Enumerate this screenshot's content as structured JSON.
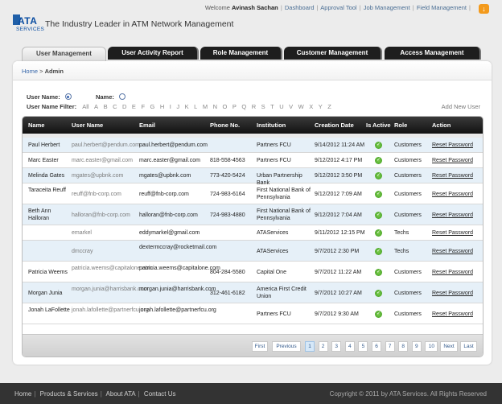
{
  "header": {
    "logo_text": "ATA",
    "logo_sub": "SERVICES",
    "tagline": "The Industry Leader in ATM Network Management",
    "welcome_prefix": "Welcome",
    "user_name": "Avinash Sachan",
    "links": [
      "Dashboard",
      "Approval Tool",
      "Job Management",
      "Field Management"
    ],
    "download_icon": "download-icon"
  },
  "tabs": [
    {
      "label": "User Management",
      "active": true
    },
    {
      "label": "User Activity Report",
      "active": false
    },
    {
      "label": "Role Management",
      "active": false
    },
    {
      "label": "Customer Management",
      "active": false
    },
    {
      "label": "Access Management",
      "active": false
    }
  ],
  "breadcrumb": {
    "home": "Home",
    "sep": ">",
    "current": "Admin"
  },
  "filters": {
    "user_name_label": "User Name:",
    "name_label": "Name:",
    "filter_label": "User Name Filter:",
    "letters": [
      "All",
      "A",
      "B",
      "C",
      "D",
      "E",
      "F",
      "G",
      "H",
      "I",
      "J",
      "K",
      "L",
      "M",
      "N",
      "O",
      "P",
      "Q",
      "R",
      "S",
      "T",
      "U",
      "V",
      "W",
      "X",
      "Y",
      "Z"
    ],
    "add_new_user": "Add New User"
  },
  "table": {
    "headers": [
      "Name",
      "User Name",
      "Email",
      "Phone No.",
      "Institution",
      "Creation Date",
      "Is Active",
      "Role",
      "Action"
    ],
    "rows": [
      {
        "name": "Paul Herbert",
        "user": "paul.herbert@pendum.com",
        "email": "paul.herbert@pendum.com",
        "phone": "",
        "inst": "Partners FCU",
        "date": "9/14/2012 11:24 AM",
        "role": "Customers",
        "action": "Reset Password"
      },
      {
        "name": "Marc Easter",
        "user": "marc.easter@gmail.com",
        "email": "marc.easter@gmail.com",
        "phone": "818-558-4563",
        "inst": "Partners FCU",
        "date": "9/12/2012 4:17 PM",
        "role": "Customers",
        "action": "Reset Password"
      },
      {
        "name": "Melinda Gates",
        "user": "mgates@upbnk.com",
        "email": "mgates@upbnk.com",
        "phone": "773-420-5424",
        "inst": "Urban Partnership Bank",
        "date": "9/12/2012 3:50 PM",
        "role": "Customers",
        "action": "Reset Password"
      },
      {
        "name": "Taraceita Reuff",
        "user": "reuff@fnb-corp.com",
        "email": "reuff@fnb-corp.com",
        "phone": "724-983-6164",
        "inst": "First National Bank of Pennsylvania",
        "date": "9/12/2012 7:09 AM",
        "role": "Customers",
        "action": "Reset Password"
      },
      {
        "name": "Beth Ann Halloran",
        "user": "halloran@fnb-corp.com",
        "email": "halloran@fnb-corp.com",
        "phone": "724-983-4880",
        "inst": "First National Bank of Pennsylvania",
        "date": "9/12/2012 7:04 AM",
        "role": "Customers",
        "action": "Reset Password"
      },
      {
        "name": "",
        "user": "emarkel",
        "email": "eddymarkel@gmail.com",
        "phone": "",
        "inst": "ATAServices",
        "date": "9/11/2012 12:15 PM",
        "role": "Techs",
        "action": "Reset Password"
      },
      {
        "name": "",
        "user": "dmccray",
        "email": "dextermccray@rocketmail.com",
        "phone": "",
        "inst": "ATAServices",
        "date": "9/7/2012 2:30 PM",
        "role": "Techs",
        "action": "Reset Password"
      },
      {
        "name": "Patricia Weems",
        "user": "patricia.weems@capitalone.com",
        "email": "patricia.weems@capitalone.com",
        "phone": "804-284-5580",
        "inst": "Capital One",
        "date": "9/7/2012 11:22 AM",
        "role": "Customers",
        "action": "Reset Password"
      },
      {
        "name": "Morgan Junia",
        "user": "morgan.junia@harrisbank.com",
        "email": "morgan.junia@harrisbank.com",
        "phone": "312-461-6182",
        "inst": "America First Credit Union",
        "date": "9/7/2012 10:27 AM",
        "role": "Customers",
        "action": "Reset Password"
      },
      {
        "name": "Jonah LaFollette",
        "user": "jonah.lafollette@partnerfcu.org",
        "email": "jonah.lafollette@partnerfcu.org",
        "phone": "",
        "inst": "Partners FCU",
        "date": "9/7/2012 9:30 AM",
        "role": "Customers",
        "action": "Reset Password"
      }
    ]
  },
  "pager": {
    "first": "First",
    "previous": "Previous",
    "pages": [
      "1",
      "2",
      "3",
      "4",
      "5",
      "6",
      "7",
      "8",
      "9",
      "10"
    ],
    "current": "1",
    "next": "Next",
    "last": "Last"
  },
  "footer": {
    "links": [
      "Home",
      "Products & Services",
      "About ATA",
      "Contact Us"
    ],
    "copyright": "Copyright © 2011 by ATA Services. All Rights Reserved"
  }
}
